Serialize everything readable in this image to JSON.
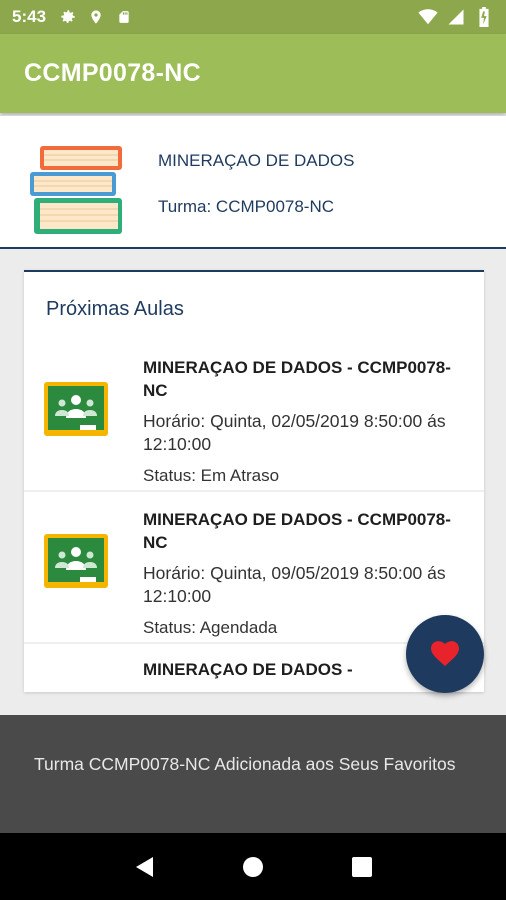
{
  "status_bar": {
    "time": "5:43",
    "icons": [
      "gear-icon",
      "location-icon",
      "sd-card-icon",
      "wifi-icon",
      "signal-icon",
      "battery-icon"
    ]
  },
  "app_bar": {
    "title": "CCMP0078-NC",
    "color": "#9cbd57"
  },
  "header": {
    "course_name": "MINERAÇAO DE DADOS",
    "class_label": "Turma: CCMP0078-NC",
    "icon": "books-icon"
  },
  "lessons": {
    "section_title": "Próximas Aulas",
    "items": [
      {
        "title": "MINERAÇAO DE DADOS - CCMP0078-NC",
        "time": "Horário: Quinta, 02/05/2019 8:50:00 ás 12:10:00",
        "status": "Status: Em Atraso",
        "icon": "classroom-icon"
      },
      {
        "title": "MINERAÇAO DE DADOS - CCMP0078-NC",
        "time": "Horário: Quinta, 09/05/2019 8:50:00 ás 12:10:00",
        "status": "Status: Agendada",
        "icon": "classroom-icon"
      },
      {
        "title": "MINERAÇAO DE DADOS -",
        "time": "",
        "status": "",
        "icon": ""
      }
    ]
  },
  "fab": {
    "icon": "heart-icon",
    "color": "#1e3a5f"
  },
  "snackbar": {
    "message": "Turma CCMP0078-NC Adicionada aos Seus Favoritos"
  },
  "nav_bar": {
    "icons": [
      "back-icon",
      "home-icon",
      "recents-icon"
    ]
  }
}
